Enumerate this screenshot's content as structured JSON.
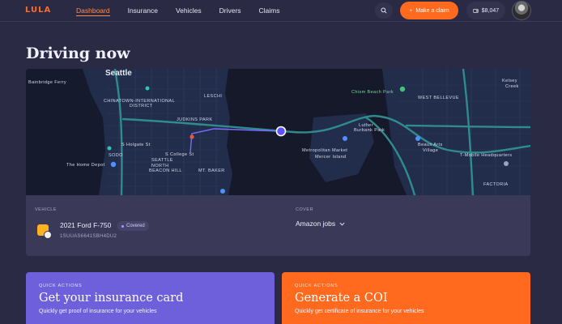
{
  "brand": {
    "logo_text": "LULA"
  },
  "nav": {
    "items": [
      {
        "label": "Dashboard",
        "active": true
      },
      {
        "label": "Insurance"
      },
      {
        "label": "Vehicles"
      },
      {
        "label": "Drivers"
      },
      {
        "label": "Claims"
      }
    ]
  },
  "header_actions": {
    "search_icon": "search-icon",
    "claim_button": "Make a claim",
    "wallet_balance": "$8,047"
  },
  "page": {
    "title": "Driving now"
  },
  "map": {
    "labels": {
      "bainbridge": "Bainbridge Ferry",
      "seattle": "Seattle",
      "chinatown": "CHINATOWN-INTERNATIONAL",
      "district": "DISTRICT",
      "leschi": "LESCHI",
      "judkins": "JUDKINS PARK",
      "sodo": "SODO",
      "home_depot": "The Home Depot",
      "north_beacon": "NORTH",
      "beacon_hill": "BEACON HILL",
      "mt_baker": "MT. BAKER",
      "seattle_uni": "SEATTLE",
      "metropolitan": "Metropolitan Market",
      "mercer": "Mercer Island",
      "luther": "Luther",
      "burbank": "Burbank Park",
      "chism": "Chism Beach Park",
      "west_bellevue": "WEST BELLEVUE",
      "kelsey": "Kelsey",
      "creek": "Creek",
      "beaux": "Beaux Arts",
      "village": "Village",
      "tmobile": "T-Mobile Headquarters",
      "factoria": "FACTORIA",
      "holgate": "S Holgate St",
      "college": "S College St"
    },
    "colors": {
      "route": "#7a6cff",
      "water": "#16192a",
      "land": "#233152",
      "road": "#2f7f86"
    }
  },
  "vehicle": {
    "section_label": "VEHICLE",
    "name": "2021 Ford F-750",
    "status": "Covered",
    "vin": "1SUUAS6641SBH4DU2"
  },
  "cover": {
    "section_label": "COVER",
    "value": "Amazon jobs"
  },
  "quick_actions": [
    {
      "eyebrow": "QUICK ACTIONS",
      "title": "Get your insurance card",
      "desc": "Quickly get proof of insurance for your vehicles",
      "color": "#6e60db"
    },
    {
      "eyebrow": "QUICK ACTIONS",
      "title": "Generate a COI",
      "desc": "Quickly get certificate of insurance for your vehicles",
      "color": "#ff6a1e"
    }
  ]
}
